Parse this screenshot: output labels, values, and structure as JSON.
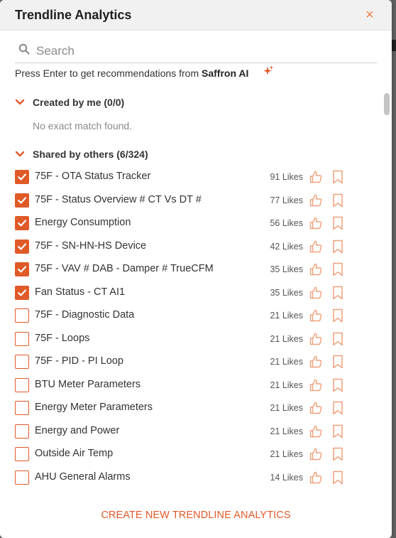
{
  "dialog": {
    "title": "Trendline Analytics",
    "close_glyph": "×"
  },
  "search": {
    "placeholder": "Search",
    "value": ""
  },
  "hint": {
    "prefix": "Press Enter to get recommendations from ",
    "brand": "Saffron AI"
  },
  "sections": {
    "mine": {
      "label": "Created by me (0/0)",
      "empty_message": "No exact match found."
    },
    "shared": {
      "label": "Shared by others (6/324)"
    }
  },
  "items": [
    {
      "name": "75F - OTA Status Tracker",
      "likes": "91 Likes",
      "checked": true
    },
    {
      "name": "75F - Status Overview # CT Vs DT #",
      "likes": "77 Likes",
      "checked": true
    },
    {
      "name": "Energy Consumption",
      "likes": "56 Likes",
      "checked": true
    },
    {
      "name": "75F - SN-HN-HS Device",
      "likes": "42 Likes",
      "checked": true
    },
    {
      "name": "75F - VAV # DAB - Damper # TrueCFM",
      "likes": "35 Likes",
      "checked": true
    },
    {
      "name": "Fan Status - CT AI1",
      "likes": "35 Likes",
      "checked": true
    },
    {
      "name": "75F - Diagnostic Data",
      "likes": "21 Likes",
      "checked": false
    },
    {
      "name": "75F - Loops",
      "likes": "21 Likes",
      "checked": false
    },
    {
      "name": "75F - PID - PI Loop",
      "likes": "21 Likes",
      "checked": false
    },
    {
      "name": "BTU Meter Parameters",
      "likes": "21 Likes",
      "checked": false
    },
    {
      "name": "Energy Meter Parameters",
      "likes": "21 Likes",
      "checked": false
    },
    {
      "name": "Energy and Power",
      "likes": "21 Likes",
      "checked": false
    },
    {
      "name": "Outside Air Temp",
      "likes": "21 Likes",
      "checked": false
    },
    {
      "name": "AHU General Alarms",
      "likes": "14 Likes",
      "checked": false
    }
  ],
  "footer": {
    "create_label": "CREATE NEW TRENDLINE ANALYTICS"
  },
  "icons": {
    "search": "search-icon",
    "sparkle": "sparkle-icon",
    "chevron": "chevron-down-icon",
    "like": "thumbs-up-icon",
    "bookmark": "bookmark-icon",
    "close": "close-icon",
    "check": "checkmark-icon"
  },
  "colors": {
    "accent": "#e05a28",
    "accent_light": "#f0814a",
    "header_bg": "#f1f1f1"
  }
}
